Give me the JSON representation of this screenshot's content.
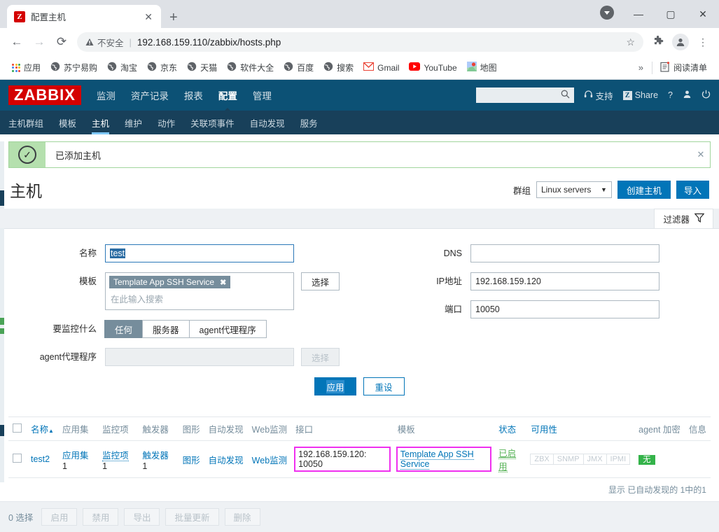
{
  "browser": {
    "tab": {
      "title": "配置主机",
      "favicon_letter": "Z",
      "close_icon": "close-icon"
    },
    "new_tab_label": "+",
    "window_controls": {
      "minimize": "—",
      "maximize": "▢",
      "close": "✕"
    },
    "nav": {
      "back": "←",
      "forward": "→",
      "reload": "⟳"
    },
    "omnibox": {
      "warning_icon": "warning-triangle-icon",
      "warning_text": "不安全",
      "url": "192.168.159.110/zabbix/hosts.php",
      "star_icon": "bookmark-star-icon"
    },
    "toolbar_icons": [
      "extensions-puzzle-icon",
      "profile-avatar-icon",
      "chrome-menu-icon"
    ],
    "bookmarks": [
      {
        "label": "应用",
        "icon": "apps-grid-icon"
      },
      {
        "label": "苏宁易购",
        "icon": "globe-icon"
      },
      {
        "label": "淘宝",
        "icon": "globe-icon"
      },
      {
        "label": "京东",
        "icon": "globe-icon"
      },
      {
        "label": "天猫",
        "icon": "globe-icon"
      },
      {
        "label": "软件大全",
        "icon": "globe-icon"
      },
      {
        "label": "百度",
        "icon": "globe-icon"
      },
      {
        "label": "搜索",
        "icon": "globe-icon"
      },
      {
        "label": "Gmail",
        "icon": "gmail-icon"
      },
      {
        "label": "YouTube",
        "icon": "youtube-icon"
      },
      {
        "label": "地图",
        "icon": "maps-icon"
      }
    ],
    "bookmarks_overflow": "»",
    "reading_list": {
      "label": "阅读清单",
      "icon": "reading-list-icon"
    }
  },
  "zabbix": {
    "logo": "ZABBIX",
    "main_nav": [
      {
        "label": "监测",
        "active": false
      },
      {
        "label": "资产记录",
        "active": false
      },
      {
        "label": "报表",
        "active": false
      },
      {
        "label": "配置",
        "active": true
      },
      {
        "label": "管理",
        "active": false
      }
    ],
    "search_placeholder": "",
    "header_actions": [
      {
        "label": "支持",
        "icon": "support-headset-icon"
      },
      {
        "label": "Share",
        "icon": "share-z-icon"
      },
      {
        "label": "?",
        "icon": "help-icon"
      },
      {
        "label": "",
        "icon": "user-icon"
      },
      {
        "label": "",
        "icon": "power-icon"
      }
    ],
    "sub_nav": [
      {
        "label": "主机群组",
        "active": false
      },
      {
        "label": "模板",
        "active": false
      },
      {
        "label": "主机",
        "active": true
      },
      {
        "label": "维护",
        "active": false
      },
      {
        "label": "动作",
        "active": false
      },
      {
        "label": "关联项事件",
        "active": false
      },
      {
        "label": "自动发现",
        "active": false
      },
      {
        "label": "服务",
        "active": false
      }
    ]
  },
  "message": {
    "text": "已添加主机",
    "icon": "success-check-icon",
    "close_icon": "close-icon",
    "border_color": "#a2d59d",
    "icon_bg_color": "#b5e0ae"
  },
  "page": {
    "title": "主机",
    "group_label": "群组",
    "group_value": "Linux servers",
    "create_host_label": "创建主机",
    "import_label": "导入"
  },
  "filter": {
    "tab_label": "过滤器",
    "tab_icon": "funnel-filter-icon",
    "fields": {
      "name_label": "名称",
      "name_value": "test",
      "template_label": "模板",
      "template_chip": "Template App SSH Service",
      "template_chip_remove": "✖",
      "template_placeholder": "在此输入搜索",
      "select_label": "选择",
      "monitored_by_label": "要监控什么",
      "monitored_by_options": [
        "任何",
        "服务器",
        "agent代理程序"
      ],
      "monitored_by_selected": "任何",
      "proxy_label": "agent代理程序",
      "proxy_value": "",
      "proxy_select_label": "选择",
      "dns_label": "DNS",
      "dns_value": "",
      "ip_label": "IP地址",
      "ip_value": "192.168.159.120",
      "port_label": "端口",
      "port_value": "10050"
    },
    "apply_label": "应用",
    "reset_label": "重设"
  },
  "table": {
    "columns": [
      "名称",
      "应用集",
      "监控项",
      "触发器",
      "图形",
      "自动发现",
      "Web监测",
      "接口",
      "模板",
      "状态",
      "可用性",
      "agent 加密",
      "信息"
    ],
    "sort_column": "名称",
    "sort_dir_icon": "▲",
    "rows": [
      {
        "name": "test2",
        "applications": {
          "label": "应用集",
          "count": "1"
        },
        "items": {
          "label": "监控项",
          "count": "1"
        },
        "triggers": {
          "label": "触发器",
          "count": "1"
        },
        "graphs": {
          "label": "图形",
          "count": ""
        },
        "discovery": {
          "label": "自动发现",
          "count": ""
        },
        "web": {
          "label": "Web监测",
          "count": ""
        },
        "interface": "192.168.159.120: 10050",
        "templates": "Template App SSH Service",
        "status": "已启用",
        "availability": [
          "ZBX",
          "SNMP",
          "JMX",
          "IPMI"
        ],
        "encryption": "无"
      }
    ],
    "footer_text": "显示 已自动发现的 1中的1",
    "highlight_color": "#ef30ef"
  },
  "bottom_bar": {
    "selected_text": "0 选择",
    "buttons": [
      "启用",
      "禁用",
      "导出",
      "批量更新",
      "删除"
    ]
  }
}
